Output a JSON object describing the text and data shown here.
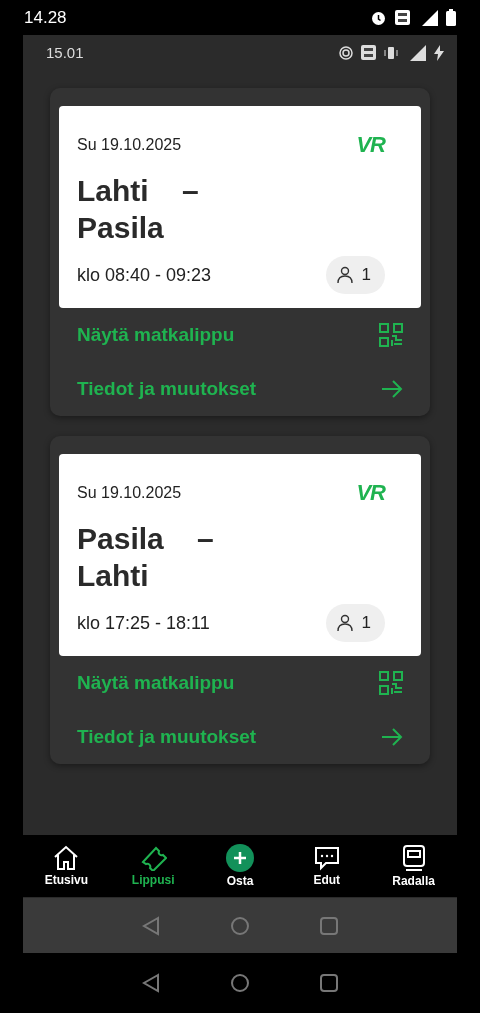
{
  "status_bar": {
    "time": "14.28"
  },
  "inner_status_bar": {
    "time": "15.01"
  },
  "tickets": [
    {
      "date": "Su 19.10.2025",
      "logo": "VR",
      "route": "Lahti    – Pasila",
      "time": "klo 08:40 - 09:23",
      "passengers": "1",
      "actions": [
        "Näytä matkalippu",
        "Tiedot ja muutokset"
      ]
    },
    {
      "date": "Su 19.10.2025",
      "logo": "VR",
      "route": "Pasila    – Lahti",
      "time": "klo 17:25 - 18:11",
      "passengers": "1",
      "actions": [
        "Näytä matkalippu",
        "Tiedot ja muutokset"
      ]
    }
  ],
  "bottom_nav": [
    {
      "label": "Etusivu",
      "kind": "home",
      "selected": false
    },
    {
      "label": "Lippusi",
      "kind": "ticket",
      "selected": true
    },
    {
      "label": "Osta",
      "kind": "buy",
      "selected": false
    },
    {
      "label": "Edut",
      "kind": "chat",
      "selected": false
    },
    {
      "label": "Radalla",
      "kind": "train",
      "selected": false
    }
  ]
}
